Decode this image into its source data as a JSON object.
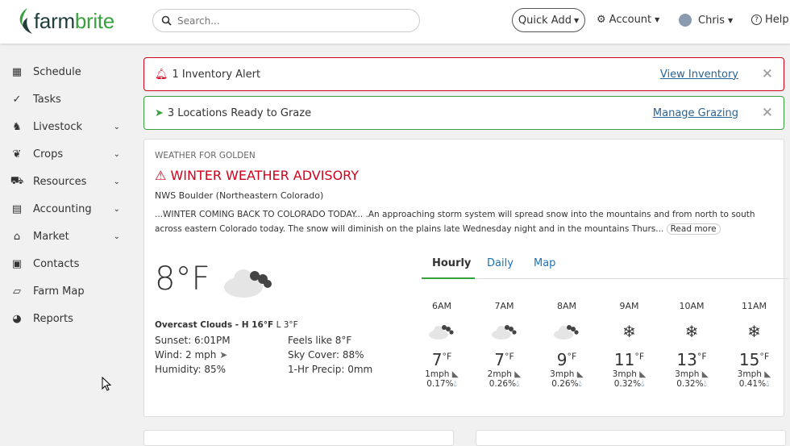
{
  "header": {
    "brand_a": "farm",
    "brand_b": "brite",
    "search_placeholder": "Search...",
    "quick_add": "Quick Add",
    "account": "Account",
    "user": "Chris",
    "help": "Help"
  },
  "sidebar": {
    "items": [
      {
        "label": "Schedule",
        "icon": "calendar-icon"
      },
      {
        "label": "Tasks",
        "icon": "check-circle-icon"
      },
      {
        "label": "Livestock",
        "icon": "horse-icon",
        "sub": true
      },
      {
        "label": "Crops",
        "icon": "seedling-icon",
        "sub": true
      },
      {
        "label": "Resources",
        "icon": "tractor-icon",
        "sub": true
      },
      {
        "label": "Accounting",
        "icon": "calculator-icon",
        "sub": true
      },
      {
        "label": "Market",
        "icon": "store-icon",
        "sub": true
      },
      {
        "label": "Contacts",
        "icon": "contact-card-icon"
      },
      {
        "label": "Farm Map",
        "icon": "map-icon"
      },
      {
        "label": "Reports",
        "icon": "pie-chart-icon"
      }
    ]
  },
  "alerts": [
    {
      "text": "1 Inventory Alert",
      "link": "View Inventory",
      "color": "#d0021b"
    },
    {
      "text": "3 Locations Ready to Graze",
      "link": "Manage Grazing",
      "color": "#3aa13f"
    }
  ],
  "weather": {
    "location": "WEATHER FOR GOLDEN",
    "advisory": "WINTER WEATHER ADVISORY",
    "source": "NWS Boulder (Northeastern Colorado)",
    "summary": "...WINTER COMING BACK TO COLORADO TODAY... .An approaching storm system will spread snow into the mountains and from north to south across eastern Colorado today. The snow will diminish on the plains late Wednesday night and in the mountains Thurs...",
    "read_more": "Read more",
    "current_temp": "8°F",
    "condition": "Overcast Clouds - H 16°F",
    "low": "L 3°F",
    "sunset": "Sunset: 6:01PM",
    "wind": "Wind: 2 mph",
    "humidity": "Humidity: 85%",
    "feels_like": "Feels like 8°F",
    "sky_cover": "Sky Cover: 88%",
    "precip": "1-Hr Precip: 0mm",
    "tabs": [
      "Hourly",
      "Daily",
      "Map"
    ],
    "hourly": [
      {
        "time": "6AM",
        "temp": "7",
        "unit": "°F",
        "wind": "1mph",
        "precip": "0.17%",
        "icon": "cloudy"
      },
      {
        "time": "7AM",
        "temp": "7",
        "unit": "°F",
        "wind": "2mph",
        "precip": "0.26%",
        "icon": "cloudy"
      },
      {
        "time": "8AM",
        "temp": "9",
        "unit": "°F",
        "wind": "3mph",
        "precip": "0.26%",
        "icon": "cloudy"
      },
      {
        "time": "9AM",
        "temp": "11",
        "unit": "°F",
        "wind": "3mph",
        "precip": "0.32%",
        "icon": "snow"
      },
      {
        "time": "10AM",
        "temp": "13",
        "unit": "°F",
        "wind": "3mph",
        "precip": "0.32%",
        "icon": "snow"
      },
      {
        "time": "11AM",
        "temp": "15",
        "unit": "°F",
        "wind": "3mph",
        "precip": "0.41%",
        "icon": "snow"
      }
    ]
  }
}
